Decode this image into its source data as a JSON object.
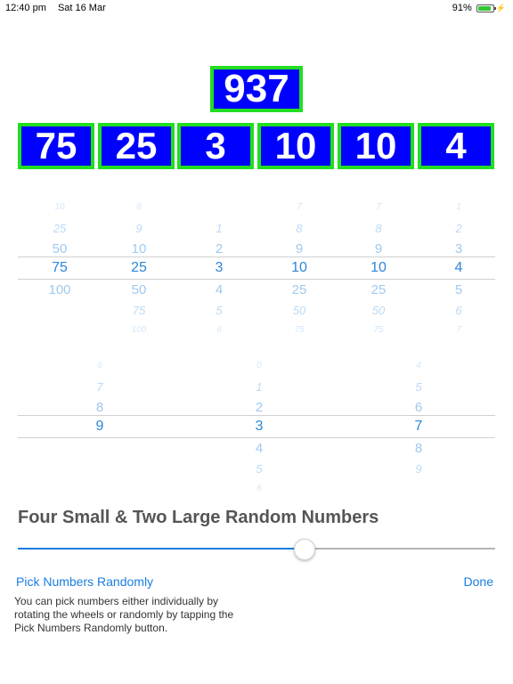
{
  "status_bar": {
    "time": "12:40 pm",
    "date": "Sat 16 Mar",
    "battery_percent": "91%",
    "battery_level": 0.91,
    "battery_color": "#33c733"
  },
  "target": {
    "value": "937",
    "tile_color": "#0000ff",
    "border_color": "#22dd22"
  },
  "numbers": [
    {
      "value": "75"
    },
    {
      "value": "25"
    },
    {
      "value": "3"
    },
    {
      "value": "10"
    },
    {
      "value": "10"
    },
    {
      "value": "4"
    }
  ],
  "number_wheels": [
    {
      "above": [
        "10",
        "25",
        "50"
      ],
      "selected": "75",
      "below": [
        "100"
      ]
    },
    {
      "above": [
        "8",
        "9",
        "10"
      ],
      "selected": "25",
      "below": [
        "50",
        "75",
        "100"
      ]
    },
    {
      "above": [
        "1",
        "2"
      ],
      "selected": "3",
      "below": [
        "4",
        "5",
        "6"
      ]
    },
    {
      "above": [
        "7",
        "8",
        "9"
      ],
      "selected": "10",
      "below": [
        "25",
        "50",
        "75"
      ]
    },
    {
      "above": [
        "7",
        "8",
        "9"
      ],
      "selected": "10",
      "below": [
        "25",
        "50",
        "75"
      ]
    },
    {
      "above": [
        "1",
        "2",
        "3"
      ],
      "selected": "4",
      "below": [
        "5",
        "6",
        "7"
      ]
    }
  ],
  "target_wheels": [
    {
      "above": [
        "6",
        "7",
        "8"
      ],
      "selected": "9",
      "below": []
    },
    {
      "above": [
        "0",
        "1",
        "2"
      ],
      "selected": "3",
      "below": [
        "4",
        "5",
        "6"
      ]
    },
    {
      "above": [
        "4",
        "5",
        "6"
      ],
      "selected": "7",
      "below": [
        "8",
        "9"
      ]
    }
  ],
  "settings": {
    "title": "Four Small & Two Large Random Numbers",
    "slider_level": 0.6,
    "accent_color": "#1a7ee0"
  },
  "buttons": {
    "pick_label": "Pick Numbers Randomly",
    "done_label": "Done"
  },
  "description": "You can pick numbers either individually by rotating the wheels or randomly by tapping the Pick Numbers Randomly button."
}
